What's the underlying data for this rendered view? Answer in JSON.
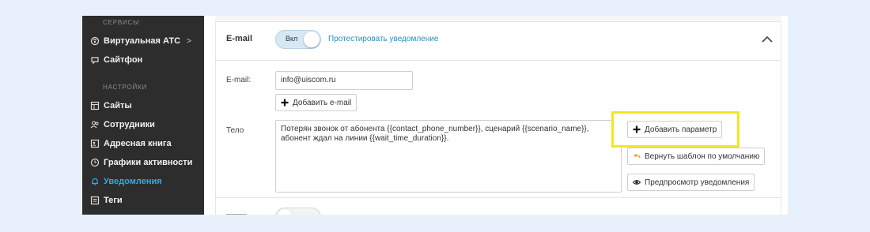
{
  "sidebar": {
    "section_services": "СЕРВИСЫ",
    "virtual_ats": "Виртуальная АТС",
    "virtual_ats_chevron": ">",
    "sitephone": "Сайтфон",
    "section_settings": "НАСТРОЙКИ",
    "items": [
      "Сайты",
      "Сотрудники",
      "Адресная книга",
      "Графики активности",
      "Уведомления",
      "Теги"
    ],
    "active_item": "Уведомления"
  },
  "email_section": {
    "title": "E-mail",
    "toggle_label": "Вкл",
    "toggle_on": true,
    "test_link": "Протестировать уведомление"
  },
  "email_field": {
    "label": "E-mail:",
    "value": "info@uiscom.ru",
    "add_button": "Добавить e-mail"
  },
  "body_field": {
    "label": "Тело",
    "text_line1": "Потерян звонок от абонента {{contact_phone_number}}, сценарий {{scenario_name}},",
    "text_line2": "абонент ждал на линии {{wait_time_duration}}.",
    "add_param_button": "Добавить параметр",
    "reset_template_button": "Вернуть шаблон по умолчанию",
    "preview_button": "Предпросмотр уведомления"
  },
  "colors": {
    "sidebar_bg": "#2d2d2d",
    "active": "#33a9e0",
    "link": "#2a8fc2",
    "highlight": "#f0e81e",
    "page_bg": "#e8f1fb"
  }
}
